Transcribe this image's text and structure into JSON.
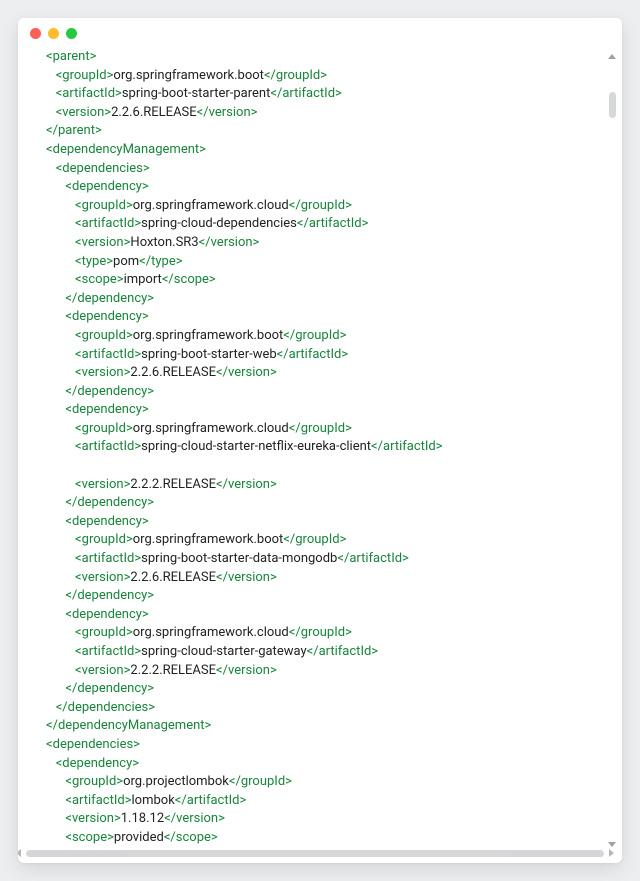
{
  "indent_unit": "   ",
  "xml": {
    "parent": {
      "groupId": "org.springframework.boot",
      "artifactId": "spring-boot-starter-parent",
      "version": "2.2.6.RELEASE"
    },
    "dependencyManagement": {
      "dependencies": [
        {
          "groupId": "org.springframework.cloud",
          "artifactId": "spring-cloud-dependencies",
          "version": "Hoxton.SR3",
          "type": "pom",
          "scope": "import"
        },
        {
          "groupId": "org.springframework.boot",
          "artifactId": "spring-boot-starter-web",
          "version": "2.2.6.RELEASE"
        },
        {
          "groupId": "org.springframework.cloud",
          "artifactId": "spring-cloud-starter-netflix-eureka-client",
          "blank_before_version": true,
          "version": "2.2.2.RELEASE"
        },
        {
          "groupId": "org.springframework.boot",
          "artifactId": "spring-boot-starter-data-mongodb",
          "version": "2.2.6.RELEASE"
        },
        {
          "groupId": "org.springframework.cloud",
          "artifactId": "spring-cloud-starter-gateway",
          "version": "2.2.2.RELEASE"
        }
      ]
    },
    "dependencies": [
      {
        "groupId": "org.projectlombok",
        "artifactId": "lombok",
        "version": "1.18.12",
        "scope": "provided"
      }
    ]
  },
  "tags": {
    "parent": "parent",
    "groupId": "groupId",
    "artifactId": "artifactId",
    "version": "version",
    "dependencyManagement": "dependencyManagement",
    "dependencies": "dependencies",
    "dependency": "dependency",
    "type": "type",
    "scope": "scope"
  },
  "window": {
    "controls": [
      "close",
      "minimize",
      "zoom"
    ]
  }
}
